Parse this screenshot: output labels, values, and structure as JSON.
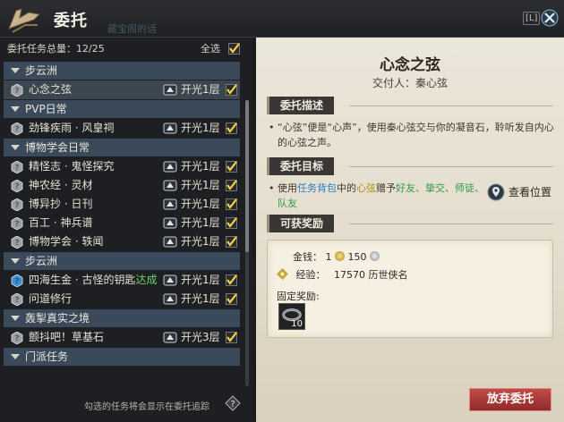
{
  "window": {
    "title": "委托",
    "watermark": "藏宝阁的话",
    "hotkey": "[L]"
  },
  "summary": {
    "label": "委托任务总量：12/25",
    "select_all": "全选"
  },
  "task_list": [
    {
      "type": "category",
      "label": "步云洲"
    },
    {
      "type": "task",
      "name": "心念之弦",
      "floor": "开光1层",
      "active": true
    },
    {
      "type": "category",
      "label": "PVP日常"
    },
    {
      "type": "task",
      "name": "劲锋疾雨 · 风皇祠",
      "floor": "开光1层"
    },
    {
      "type": "category",
      "label": "博物学会日常"
    },
    {
      "type": "task",
      "name": "精怪志 · 鬼怪探究",
      "floor": "开光1层"
    },
    {
      "type": "task",
      "name": "神农经 · 灵材",
      "floor": "开光1层"
    },
    {
      "type": "task",
      "name": "博异抄 · 日刊",
      "floor": "开光1层"
    },
    {
      "type": "task",
      "name": "百工 · 神兵谱",
      "floor": "开光1层"
    },
    {
      "type": "task",
      "name": "博物学会 · 轶闻",
      "floor": "开光1层"
    },
    {
      "type": "category",
      "label": "步云洲"
    },
    {
      "type": "task",
      "name": "四海生金 · 古怪的钥匙",
      "suffix": "达成",
      "floor": "开光1层",
      "blue_icon": true
    },
    {
      "type": "task",
      "name": "问道修行",
      "floor": "开光1层"
    },
    {
      "type": "category",
      "label": "轰掣真实之境"
    },
    {
      "type": "task",
      "name": "颤抖吧！草基石",
      "floor": "开光3层"
    },
    {
      "type": "category",
      "label": "门派任务"
    }
  ],
  "footer_note": "勾选的任务将会显示在委托追踪",
  "detail": {
    "title": "心念之弦",
    "giver": "交付人：秦心弦",
    "desc_header": "委托描述",
    "desc_text": "“心弦”便是“心声”，使用秦心弦交与你的凝音石，聆听发自内心的心弦之声。",
    "goal_header": "委托目标",
    "goal_parts": [
      "使用",
      "任务背包",
      "中的",
      "心弦",
      "赠予",
      "好友、挚交、师徒、队友"
    ],
    "view_position": "查看位置",
    "reward_header": "可获奖励",
    "money_label": "金钱：",
    "money_gold": "1",
    "money_silver": "150",
    "exp_label": "经验：",
    "exp_value": "17570 历世侠名",
    "fixed_label": "固定奖励:",
    "item_count": "10",
    "abandon_button": "放弃委托"
  },
  "colors": {
    "accent_green": "#6fd36f",
    "category_bg": "#3a4a5a",
    "abandon": "#a83836"
  }
}
